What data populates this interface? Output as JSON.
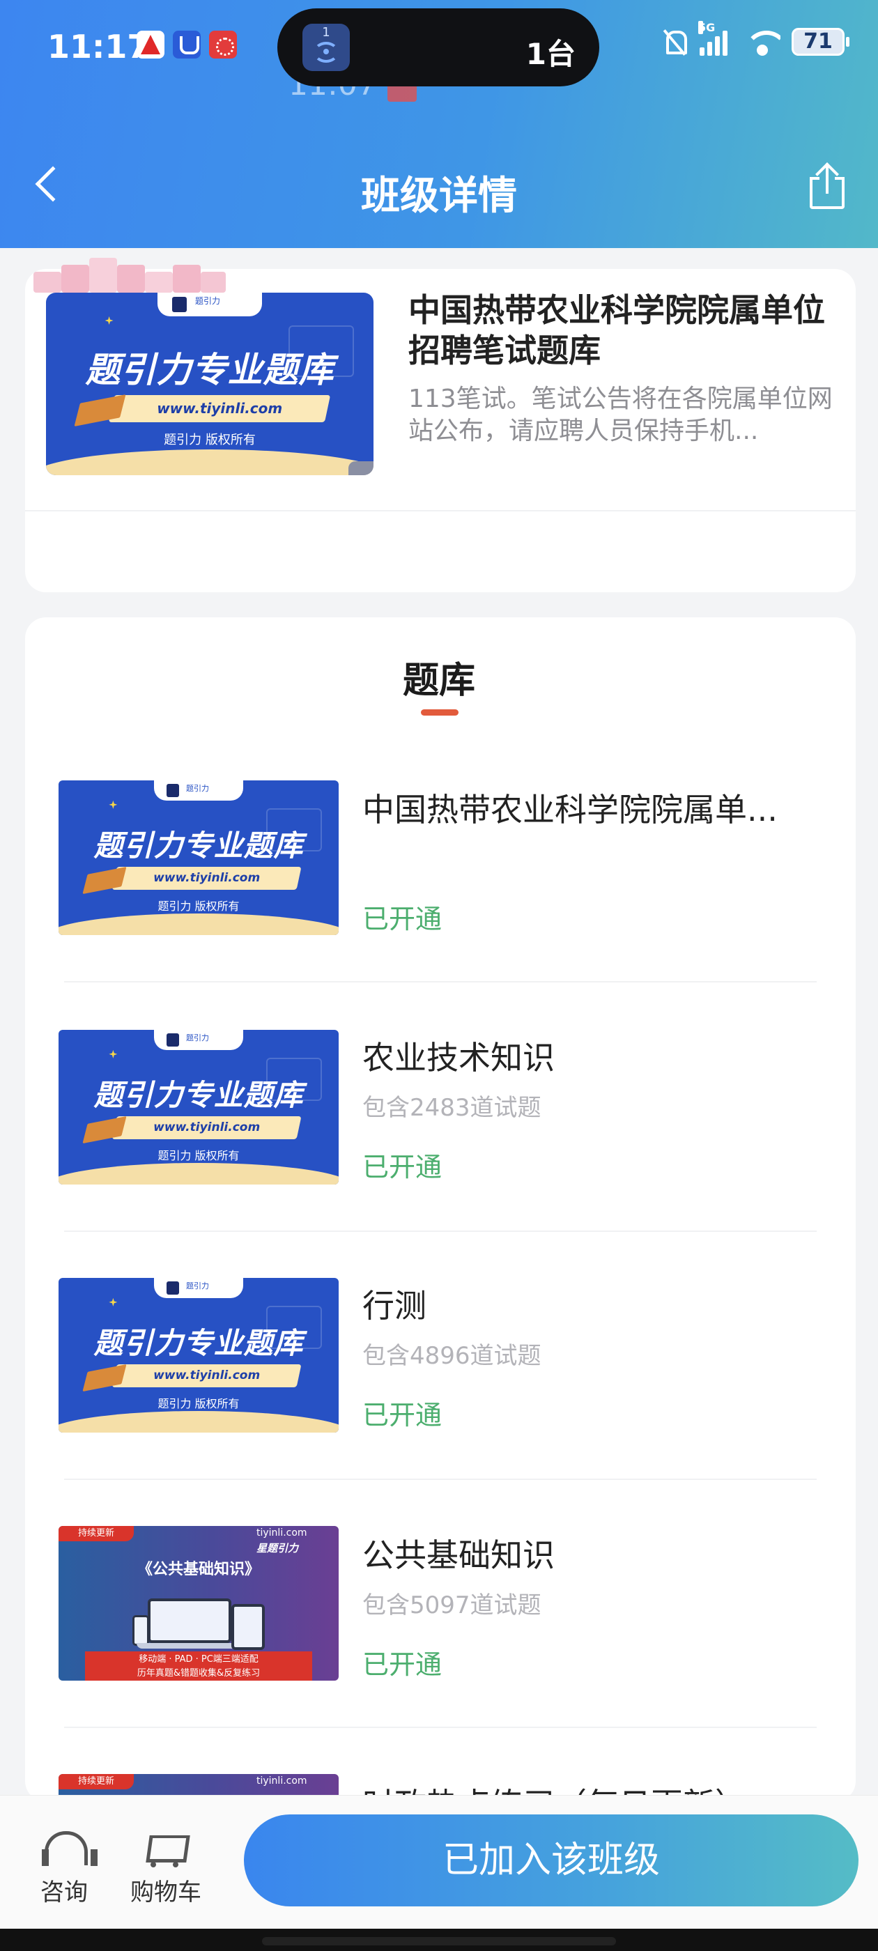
{
  "status_bar": {
    "time": "11:17",
    "island_count": "1",
    "island_text": "1台",
    "ghost_time": "11:07",
    "network": "5G",
    "battery": "71"
  },
  "nav": {
    "title": "班级详情",
    "back_icon": "chevron-left-icon",
    "share_icon": "share-icon"
  },
  "class_card": {
    "title": "中国热带农业科学院院属单位招聘笔试题库",
    "description": "113笔试。笔试公告将在各院属单位网站公布，请应聘人员保持手机...",
    "cover": {
      "brand": "题引力",
      "headline": "题引力专业题库",
      "url": "www.tiyinli.com",
      "rights": "题引力 版权所有"
    }
  },
  "question_bank": {
    "section_title": "题库",
    "items": [
      {
        "title": "中国热带农业科学院院属单...",
        "count": "",
        "status": "已开通",
        "cover": "tiyinli"
      },
      {
        "title": "农业技术知识",
        "count": "包含2483道试题",
        "status": "已开通",
        "cover": "tiyinli"
      },
      {
        "title": "行测",
        "count": "包含4896道试题",
        "status": "已开通",
        "cover": "tiyinli"
      },
      {
        "title": "公共基础知识",
        "count": "包含5097道试题",
        "status": "已开通",
        "cover": "gongji"
      },
      {
        "title": "时政热点练习（每日更新）",
        "count": "",
        "status": "",
        "cover": "gongji"
      }
    ],
    "gongji_cover": {
      "tag": "持续更新",
      "brand": "tiyinli.com",
      "mark": "星题引力",
      "title": "《公共基础知识》",
      "band_line1": "移动端 · PAD · PC端三端适配",
      "band_line2": "历年真题&错题收集&反复练习"
    }
  },
  "bottom_bar": {
    "consult": "咨询",
    "cart": "购物车",
    "join_button": "已加入该班级"
  }
}
